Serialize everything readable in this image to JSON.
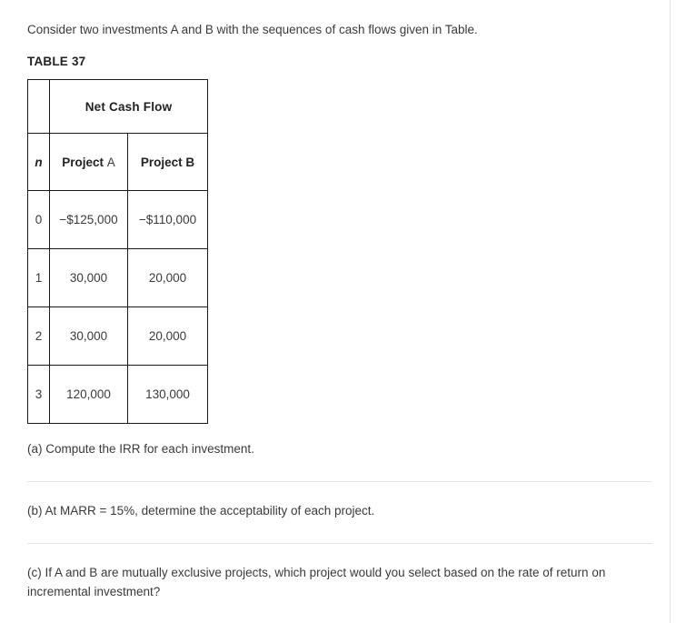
{
  "intro": {
    "text": "Consider two investments A and B with the sequences of cash flows given in Table."
  },
  "table": {
    "caption": "TABLE 37",
    "group_header": "Net Cash Flow",
    "blank_corner": "",
    "columns": {
      "index": "n",
      "project_a_label": "Project",
      "project_a_letter": "A",
      "project_b_label": "Project",
      "project_b_letter": "B"
    },
    "rows": [
      {
        "n": "0",
        "project_a": "−$125,000",
        "project_b": "−$110,000"
      },
      {
        "n": "1",
        "project_a": "30,000",
        "project_b": "20,000"
      },
      {
        "n": "2",
        "project_a": "30,000",
        "project_b": "20,000"
      },
      {
        "n": "3",
        "project_a": "120,000",
        "project_b": "130,000"
      }
    ]
  },
  "questions": [
    {
      "id": "a",
      "text": "(a) Compute the IRR for each investment."
    },
    {
      "id": "b",
      "text": "(b) At MARR = 15%, determine the acceptability of each project."
    },
    {
      "id": "c",
      "text": "(c) If A and B are mutually exclusive projects, which project would you select based on the rate of return on incremental investment?"
    }
  ],
  "colors": {
    "text": "#3a3a3a",
    "heading": "#222222",
    "table_border": "#1a1a1a",
    "divider": "#e4e4e4",
    "page_rule": "#e2e2e2",
    "background": "#ffffff"
  }
}
